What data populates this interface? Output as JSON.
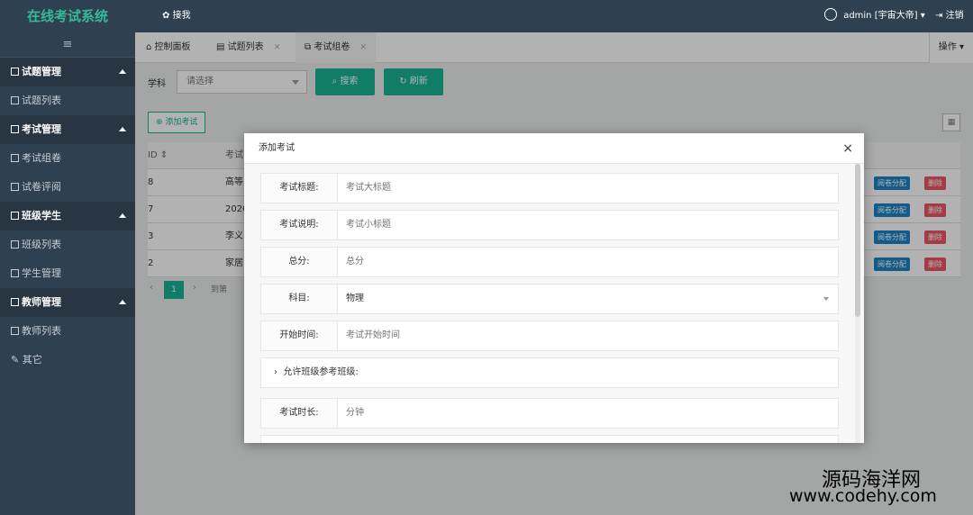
{
  "app": {
    "title": "在线考试系统",
    "top_link": "接我",
    "user": "admin [宇宙大帝]",
    "logout": "注销"
  },
  "sidebar": {
    "toggle_icon": "≡",
    "groups": [
      {
        "label": "试题管理",
        "items": [
          "试题列表"
        ]
      },
      {
        "label": "考试管理",
        "items": [
          "考试组卷",
          "试卷评阅"
        ]
      },
      {
        "label": "班级学生",
        "items": [
          "班级列表",
          "学生管理"
        ]
      },
      {
        "label": "教师管理",
        "items": [
          "教师列表"
        ]
      }
    ],
    "other": "其它"
  },
  "tabs": [
    {
      "label": "控制面板",
      "icon": "home-icon"
    },
    {
      "label": "试题列表",
      "icon": "document-icon"
    },
    {
      "label": "考试组卷",
      "icon": "copy-icon"
    }
  ],
  "ops_label": "操作",
  "filter": {
    "subject_label": "学科",
    "subject_placeholder": "请选择",
    "search": "搜索",
    "refresh": "刷新"
  },
  "toolbar": {
    "add_exam": "添加考试"
  },
  "table": {
    "headers": [
      "ID",
      "考试"
    ],
    "rows": [
      {
        "id": "8",
        "title": "高等"
      },
      {
        "id": "7",
        "title": "2020"
      },
      {
        "id": "3",
        "title": "李义"
      },
      {
        "id": "2",
        "title": "家居"
      }
    ],
    "assign_label": "阅卷分配",
    "delete_label": "删除"
  },
  "pager": {
    "current": "1",
    "text": "到第"
  },
  "modal": {
    "title": "添加考试",
    "close": "×",
    "fields": [
      {
        "label": "考试标题:",
        "placeholder": "考试大标题"
      },
      {
        "label": "考试说明:",
        "placeholder": "考试小标题"
      },
      {
        "label": "总分:",
        "placeholder": "总分"
      },
      {
        "label": "科目:",
        "value": "物理"
      },
      {
        "label": "开始时间:",
        "placeholder": "考试开始时间"
      }
    ],
    "collapse_label": "允许班级参考班级:",
    "duration": {
      "label": "考试时长:",
      "placeholder": "分钟"
    }
  },
  "watermark": {
    "line1": "源码海洋网",
    "line2": "www.codehy.com"
  },
  "colors": {
    "primary": "#1ab394",
    "sidebar": "#2f4050",
    "brand": "#35b99a",
    "info": "#1c84c6",
    "danger": "#ed5565"
  }
}
